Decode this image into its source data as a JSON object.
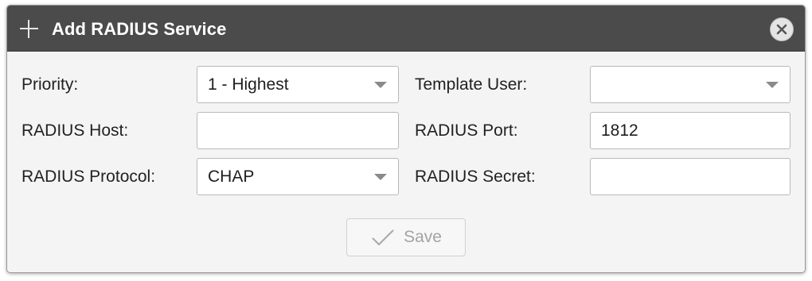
{
  "dialog": {
    "title": "Add RADIUS Service",
    "plus_icon": "plus-icon",
    "close_icon": "close-icon"
  },
  "form": {
    "priority": {
      "label": "Priority:",
      "value": "1 - Highest"
    },
    "template_user": {
      "label": "Template User:",
      "value": ""
    },
    "radius_host": {
      "label": "RADIUS Host:",
      "value": ""
    },
    "radius_port": {
      "label": "RADIUS Port:",
      "value": "1812"
    },
    "radius_protocol": {
      "label": "RADIUS Protocol:",
      "value": "CHAP"
    },
    "radius_secret": {
      "label": "RADIUS Secret:",
      "value": ""
    }
  },
  "actions": {
    "save_label": "Save",
    "save_icon": "checkmark-icon",
    "save_disabled": true
  },
  "colors": {
    "titlebar": "#4b4b4b",
    "dialog_bg": "#f4f4f4",
    "disabled_text": "#a3a3a3"
  }
}
